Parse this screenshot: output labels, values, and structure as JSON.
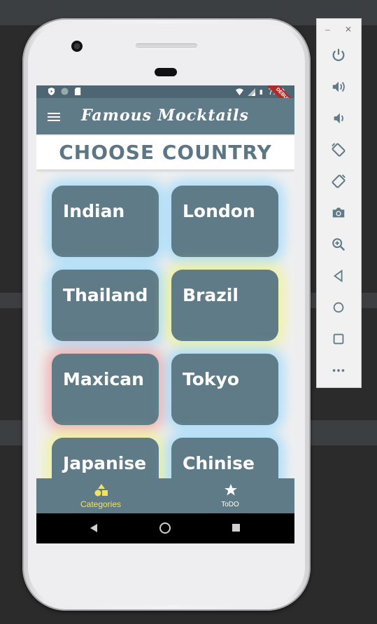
{
  "status_bar": {
    "time": "7:49",
    "debug_banner": "DEBUG"
  },
  "app_bar": {
    "title": "Famous Mocktails"
  },
  "header": {
    "title": "CHOOSE COUNTRY"
  },
  "countries": [
    "Indian",
    "London",
    "Thailand",
    "Brazil",
    "Maxican",
    "Tokyo",
    "Japanise",
    "Chinise"
  ],
  "bottom_nav": {
    "items": [
      {
        "label": "Categories",
        "icon": "categories-icon",
        "active": true
      },
      {
        "label": "ToDO",
        "icon": "star-icon",
        "active": false
      }
    ]
  },
  "emulator_toolbar": {
    "minimize": "–",
    "close": "✕",
    "buttons": [
      "power-icon",
      "volume-up-icon",
      "volume-down-icon",
      "rotate-left-icon",
      "rotate-right-icon",
      "camera-icon",
      "zoom-icon",
      "back-icon",
      "home-icon",
      "overview-icon",
      "more-icon"
    ]
  },
  "colors": {
    "accent_yellow": "#f3e35a",
    "primary": "#5f7b87",
    "status_bar": "#4e6673",
    "glow_colors": [
      "#7fd0ff",
      "#7fd0ff",
      "#7fd0ff",
      "#f0f36b",
      "#f08a8a",
      "#7fd0ff",
      "#f0f36b",
      "#7fd0ff"
    ]
  }
}
